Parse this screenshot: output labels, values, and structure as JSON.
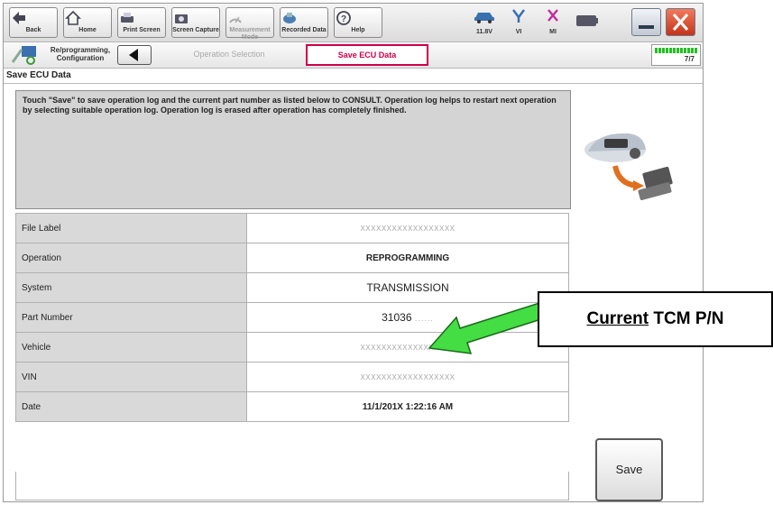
{
  "toolbar": {
    "buttons": [
      {
        "label": "Back"
      },
      {
        "label": "Home"
      },
      {
        "label": "Print Screen"
      },
      {
        "label": "Screen Capture"
      },
      {
        "label": "Measurement Mode"
      },
      {
        "label": "Recorded Data"
      },
      {
        "label": "Help"
      }
    ],
    "status": [
      {
        "label": "11.8V"
      },
      {
        "label": "VI"
      },
      {
        "label": "MI"
      }
    ]
  },
  "breadcrumb": {
    "root": "Re/programming, Configuration",
    "previous": "Operation Selection",
    "current": "Save ECU Data",
    "progress_text": "7/7",
    "progress_fraction": 1.0
  },
  "section_title": "Save ECU Data",
  "message": "Touch \"Save\" to save operation log and the current part number as listed below to CONSULT. Operation log helps to restart next operation by selecting suitable operation log. Operation log is erased after operation has completely finished.",
  "table": [
    {
      "key": "File Label",
      "value": "XXXXXXXXXXXXXXXXXX"
    },
    {
      "key": "Operation",
      "value": "REPROGRAMMING"
    },
    {
      "key": "System",
      "value": "TRANSMISSION"
    },
    {
      "key": "Part Number",
      "value": "31036",
      "value_mask": "......"
    },
    {
      "key": "Vehicle",
      "value": "XXXXXXXXXXXXXXXXXX"
    },
    {
      "key": "VIN",
      "value": "XXXXXXXXXXXXXXXXXX"
    },
    {
      "key": "Date",
      "value": "11/1/201X 1:22:16 AM"
    }
  ],
  "save_label": "Save",
  "callout": {
    "underlined": "Current",
    "rest": " TCM P/N"
  },
  "colors": {
    "accent": "#d0004a",
    "arrow": "#44dd44",
    "callout_text": "#000000"
  }
}
